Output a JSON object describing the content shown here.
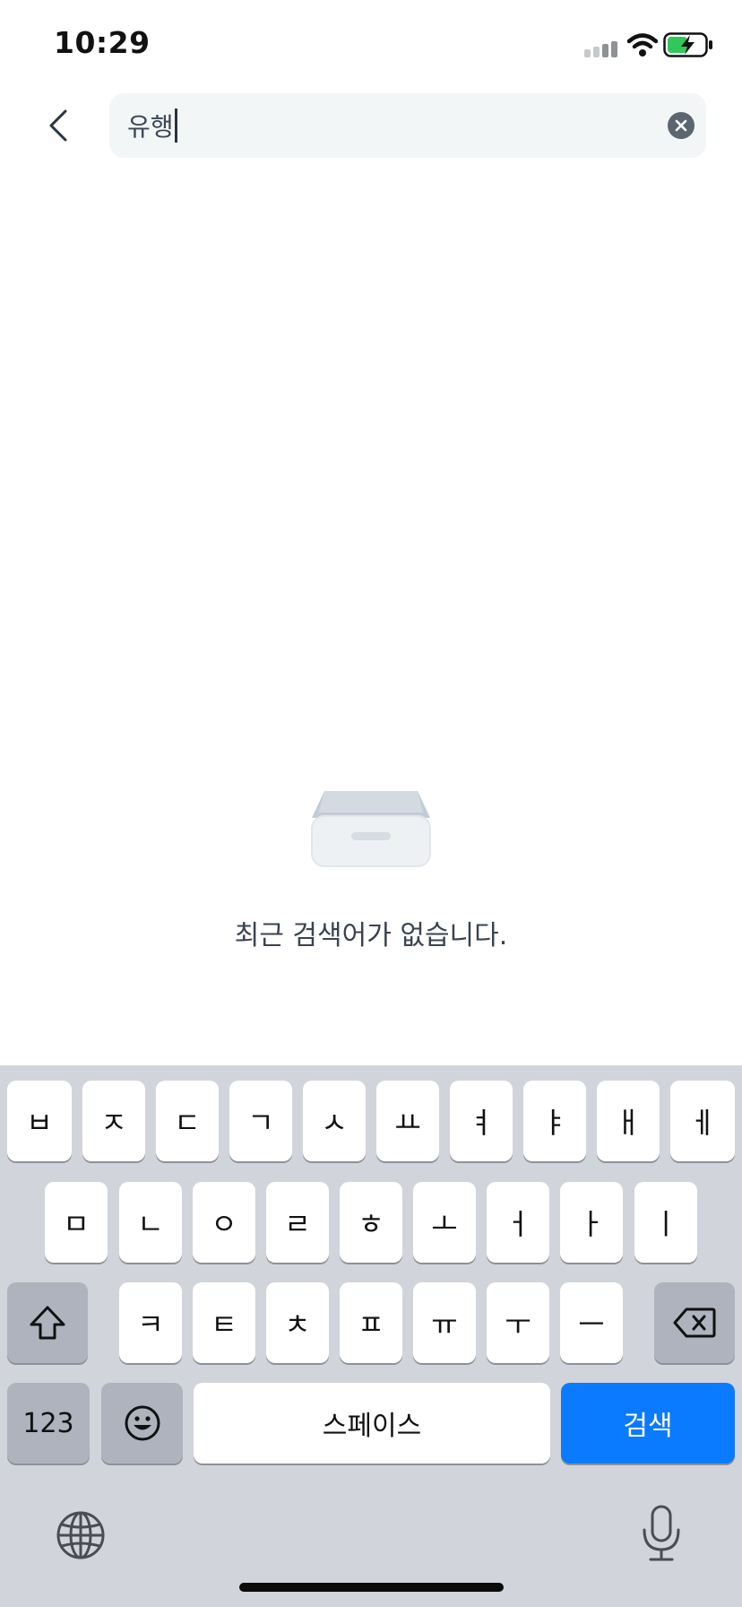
{
  "status_bar": {
    "time": "10:29",
    "icons": [
      "cellular-signal-icon",
      "wifi-icon",
      "battery-charging-icon"
    ]
  },
  "header": {
    "back_icon": "chevron-left-icon",
    "search": {
      "value": "유행",
      "clear_icon": "clear-circle-icon"
    }
  },
  "empty_state": {
    "icon": "empty-tray-icon",
    "message": "최근 검색어가 없습니다."
  },
  "keyboard": {
    "row1": [
      "ㅂ",
      "ㅈ",
      "ㄷ",
      "ㄱ",
      "ㅅ",
      "ㅛ",
      "ㅕ",
      "ㅑ",
      "ㅐ",
      "ㅔ"
    ],
    "row2": [
      "ㅁ",
      "ㄴ",
      "ㅇ",
      "ㄹ",
      "ㅎ",
      "ㅗ",
      "ㅓ",
      "ㅏ",
      "ㅣ"
    ],
    "row3": [
      "ㅋ",
      "ㅌ",
      "ㅊ",
      "ㅍ",
      "ㅠ",
      "ㅜ",
      "ㅡ"
    ],
    "shift_icon": "shift-icon",
    "delete_icon": "delete-backspace-icon",
    "numbers_label": "123",
    "emoji_icon": "emoji-icon",
    "space_label": "스페이스",
    "search_label": "검색",
    "globe_icon": "globe-icon",
    "mic_icon": "microphone-icon",
    "accent_color": "#0a7aff"
  }
}
